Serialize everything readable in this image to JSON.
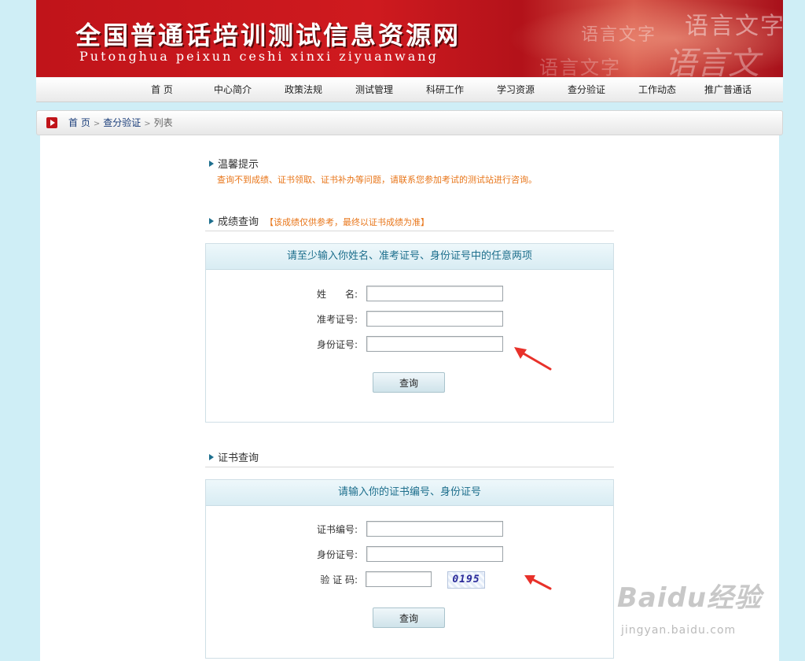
{
  "banner": {
    "title": "全国普通话培训测试信息资源网",
    "subtitle": "Putonghua peixun ceshi xinxi ziyuanwang",
    "deco1": "语言文字",
    "deco2": "语言文字",
    "deco3": "语言文字",
    "deco4": "语言文"
  },
  "nav": {
    "items": [
      "首 页",
      "中心简介",
      "政策法规",
      "测试管理",
      "科研工作",
      "学习资源",
      "查分验证",
      "工作动态",
      "推广普通话"
    ]
  },
  "breadcrumb": {
    "home": "首 页",
    "section": "查分验证",
    "page": "列表",
    "separator": ">"
  },
  "notice": {
    "title": "温馨提示",
    "text": "查询不到成绩、证书领取、证书补办等问题，请联系您参加考试的测试站进行咨询。"
  },
  "score_query": {
    "title": "成绩查询",
    "hint": "【该成绩仅供参考，最终以证书成绩为准】",
    "panel_header": "请至少输入你姓名、准考证号、身份证号中的任意两项",
    "name_label": "姓　　名:",
    "ticket_label": "准考证号:",
    "id_label": "身份证号:",
    "name_value": "",
    "ticket_value": "",
    "id_value": "",
    "submit_label": "查询"
  },
  "cert_query": {
    "title": "证书查询",
    "panel_header": "请输入你的证书编号、身份证号",
    "cert_label": "证书编号:",
    "id_label": "身份证号:",
    "captcha_label": "验 证 码:",
    "cert_value": "",
    "id_value": "",
    "captcha_value": "",
    "captcha_image_text": "0195",
    "submit_label": "查询"
  },
  "annotation_color": "#e8312a",
  "watermark": {
    "logo": "Baidu经验",
    "url": "jingyan.baidu.com"
  }
}
